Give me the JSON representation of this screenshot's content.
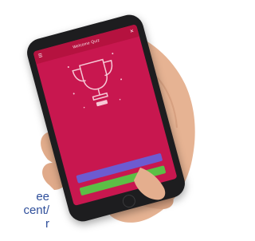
{
  "caption": {
    "line1": "ee",
    "line2": "cent/",
    "line3": "r"
  },
  "app": {
    "header_title": "Welcome Quiz",
    "menu_icon": "menu-icon",
    "close_icon": "close-icon",
    "trophy_icon": "trophy-icon",
    "score_badge": "",
    "result_line1": "",
    "result_line2": "",
    "primary_button": "",
    "secondary_button": ""
  },
  "colors": {
    "screen_bg": "#c8174f",
    "appbar_bg": "#b5123f",
    "primary_button": "#6d5bd0",
    "secondary_button": "#5cbf45",
    "caption_text": "#2f4f9b"
  }
}
